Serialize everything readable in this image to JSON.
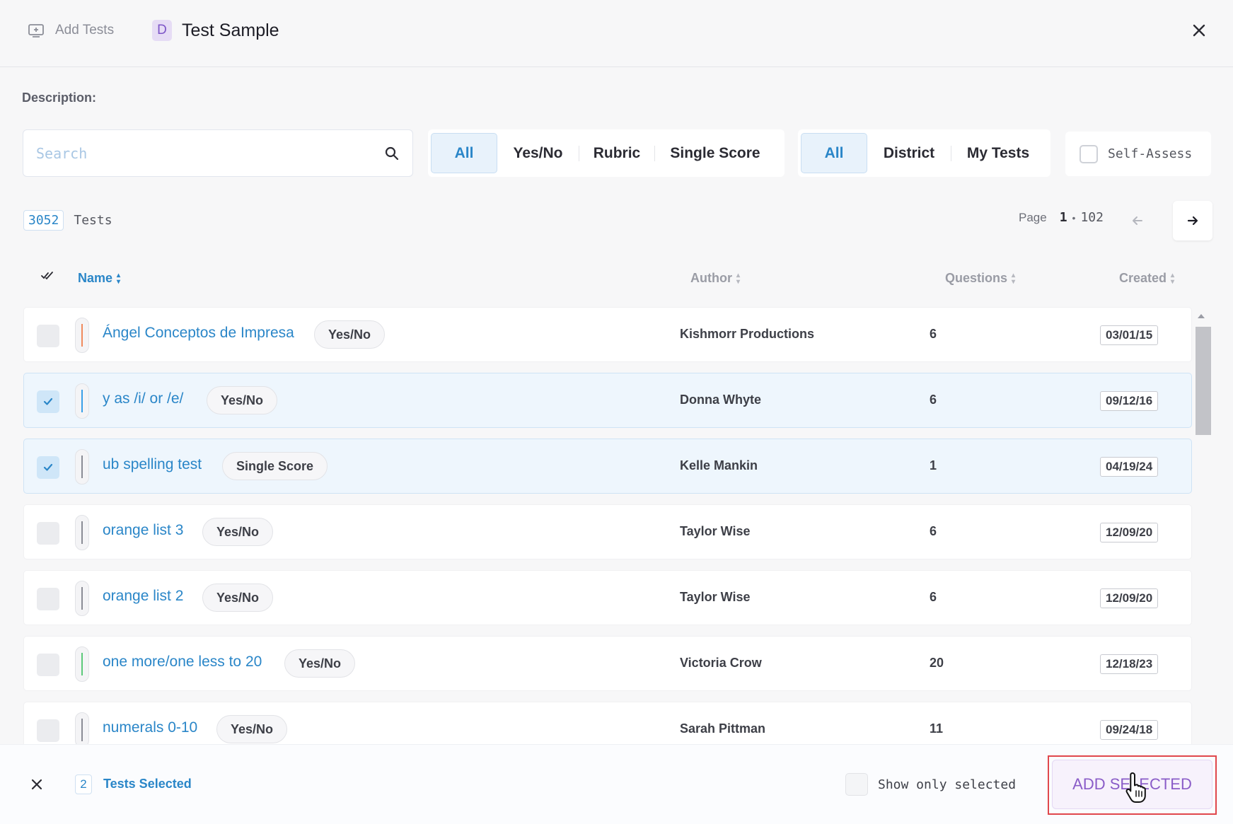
{
  "header": {
    "add_tests_label": "Add Tests",
    "badge_letter": "D",
    "title": "Test Sample"
  },
  "description_label": "Description:",
  "search": {
    "placeholder": "Search"
  },
  "type_filter": {
    "options": [
      "All",
      "Yes/No",
      "Rubric",
      "Single Score"
    ],
    "selected": "All"
  },
  "source_filter": {
    "options": [
      "All",
      "District",
      "My Tests"
    ],
    "selected": "All"
  },
  "self_assess": {
    "label": "Self-Assess",
    "checked": false
  },
  "count": {
    "value": "3052",
    "label": "Tests"
  },
  "pager": {
    "label": "Page",
    "current": "1",
    "total": "102"
  },
  "table": {
    "columns": {
      "name": "Name",
      "author": "Author",
      "questions": "Questions",
      "created": "Created"
    },
    "rows": [
      {
        "name": "Ángel Conceptos de Impresa",
        "type": "Yes/No",
        "author": "Kishmorr Productions",
        "questions": "6",
        "created": "03/01/15",
        "selected": false,
        "color": "#f08a5d"
      },
      {
        "name": "y as /i/ or /e/",
        "type": "Yes/No",
        "author": "Donna Whyte",
        "questions": "6",
        "created": "09/12/16",
        "selected": true,
        "color": "#3aa0e8"
      },
      {
        "name": "ub spelling test",
        "type": "Single Score",
        "author": "Kelle Mankin",
        "questions": "1",
        "created": "04/19/24",
        "selected": true,
        "color": "#8a8c95"
      },
      {
        "name": "orange list 3",
        "type": "Yes/No",
        "author": "Taylor Wise",
        "questions": "6",
        "created": "12/09/20",
        "selected": false,
        "color": "#8a8c95"
      },
      {
        "name": "orange list 2",
        "type": "Yes/No",
        "author": "Taylor Wise",
        "questions": "6",
        "created": "12/09/20",
        "selected": false,
        "color": "#8a8c95"
      },
      {
        "name": "one more/one less to 20",
        "type": "Yes/No",
        "author": "Victoria Crow",
        "questions": "20",
        "created": "12/18/23",
        "selected": false,
        "color": "#5cc97a"
      },
      {
        "name": "numerals 0-10",
        "type": "Yes/No",
        "author": "Sarah Pittman",
        "questions": "11",
        "created": "09/24/18",
        "selected": false,
        "color": "#8a8c95"
      }
    ]
  },
  "footer": {
    "selected_count": "2",
    "selected_label": "Tests Selected",
    "show_only_selected_label": "Show only selected",
    "add_button_label": "ADD SELECTED"
  },
  "colors": {
    "accent": "#2a86c8",
    "add_button_text": "#8a5cc8",
    "highlight_outline": "#e0474c"
  }
}
